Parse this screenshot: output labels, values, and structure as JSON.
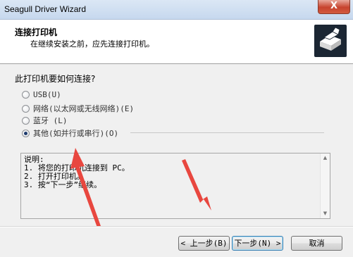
{
  "window": {
    "title": "Seagull Driver Wizard",
    "close_symbol": "X"
  },
  "header": {
    "title": "连接打印机",
    "subtitle": "在继续安装之前，应先连接打印机。",
    "icon": "printer-icon"
  },
  "question": "此打印机要如何连接?",
  "options": [
    {
      "label": "USB(U)",
      "checked": false
    },
    {
      "label": "网络(以太网或无线网络)(E)",
      "checked": false
    },
    {
      "label": "蓝牙 (L)",
      "checked": false
    },
    {
      "label": "其他(如并行或串行)(O)",
      "checked": true
    }
  ],
  "description": {
    "lines": [
      "说明:",
      "1. 将您的打印机连接到 PC。",
      "2. 打开打印机。",
      "3. 按“下一步”继续。"
    ]
  },
  "buttons": {
    "back": "< 上一步(B)",
    "next": "下一步(N) >",
    "cancel": "取消"
  }
}
